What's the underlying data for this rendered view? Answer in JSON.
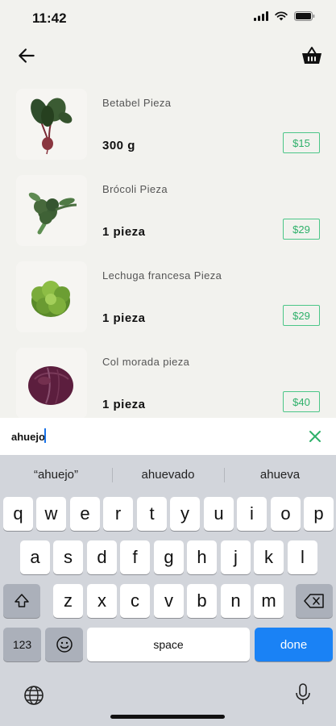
{
  "status": {
    "time": "11:42"
  },
  "products": [
    {
      "name": "Betabel Pieza",
      "quantity": "300 g",
      "price": "$15",
      "image": "beet-image"
    },
    {
      "name": "Brócoli Pieza",
      "quantity": "1 pieza",
      "price": "$29",
      "image": "broccoli-image"
    },
    {
      "name": "Lechuga francesa Pieza",
      "quantity": "1 pieza",
      "price": "$29",
      "image": "lettuce-image"
    },
    {
      "name": "Col morada pieza",
      "quantity": "1 pieza",
      "price": "$40",
      "image": "red-cabbage-image"
    }
  ],
  "search": {
    "value": "ahuejo"
  },
  "keyboard": {
    "suggestions": [
      "“ahuejo”",
      "ahuevado",
      "ahueva"
    ],
    "row1": [
      "q",
      "w",
      "e",
      "r",
      "t",
      "y",
      "u",
      "i",
      "o",
      "p"
    ],
    "row2": [
      "a",
      "s",
      "d",
      "f",
      "g",
      "h",
      "j",
      "k",
      "l"
    ],
    "row3": [
      "z",
      "x",
      "c",
      "v",
      "b",
      "n",
      "m"
    ],
    "numbers_label": "123",
    "space_label": "space",
    "done_label": "done"
  },
  "colors": {
    "accent_green": "#2eb06a",
    "keyboard_done": "#1a82f5",
    "background": "#f2f2ee"
  }
}
